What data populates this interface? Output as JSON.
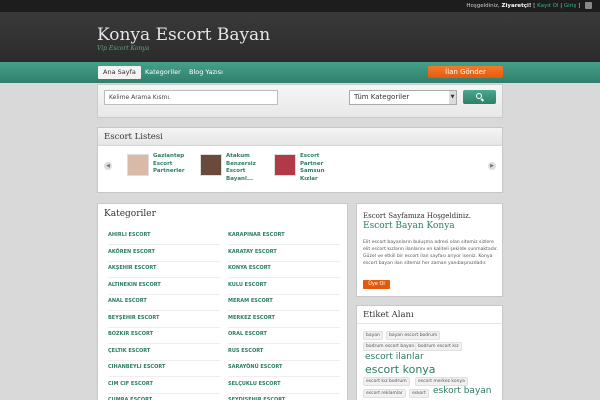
{
  "topbar": {
    "greeting": "Hoşgeldiniz, ",
    "user": "Ziyaretçi!",
    "register": "Kayıt Ol",
    "sep": " | ",
    "login": "Giriş"
  },
  "header": {
    "title": "Konya Escort Bayan",
    "subtitle": "Vip Escort Konya"
  },
  "nav": {
    "items": [
      "Ana Sayfa",
      "Kategoriler",
      "Blog Yazısı"
    ],
    "send_button": "İlan Gönder"
  },
  "search": {
    "placeholder": "Kelime Arama Kısmı.",
    "category_selected": "Tüm Kategoriler"
  },
  "escort_list": {
    "title": "Escort Listesi",
    "items": [
      {
        "name": "Gaziantep Escort Partnerler"
      },
      {
        "name": "Atakum Benzersiz Escort Bayanl..."
      },
      {
        "name": "Escort Partner Samsun Kızlar"
      }
    ]
  },
  "categories": {
    "title": "Kategoriler",
    "left": [
      "AHIRLI ESCORT",
      "AKÖREN ESCORT",
      "AKŞEHIR ESCORT",
      "ALTINEKIN ESCORT",
      "ANAL ESCORT",
      "BEYŞEHIR ESCORT",
      "BOZKIR ESCORT",
      "ÇELTIK ESCORT",
      "CIHANBEYLI ESCORT",
      "CIM CIF ESCORT",
      "CUMRA ESCORT"
    ],
    "right": [
      "KARAPINAR ESCORT",
      "KARATAY ESCORT",
      "KONYA ESCORT",
      "KULU ESCORT",
      "MERAM ESCORT",
      "MERKEZ ESCORT",
      "ORAL ESCORT",
      "RUS ESCORT",
      "SARAYÖNÜ ESCORT",
      "SELÇUKLU ESCORT",
      "SEYDIŞEHIR ESCORT"
    ]
  },
  "welcome": {
    "line1": "Escort Sayfamıza Hoşgeldiniz.",
    "line2": "Escort Bayan Konya",
    "body": "Elit escort bayanların buluşma adresi olan sitemiz sizlere elit escort kızların ilanlarını en kaliteli şekilde sunmaktadır. Güzel ve etkili bir escort ilan sayfası arıyor iseniz. Konya escort bayan ilan sitemiz her zaman yanıbaşınızdadır.",
    "button": "Üye Ol"
  },
  "tags": {
    "title": "Etiket Alanı",
    "items": [
      "bayan",
      "bayan escort bodrum",
      "bodrum escort bayan",
      "bodrum escort kız",
      "escort ilanlar",
      "escort konya",
      "escort kız bodrum",
      "escort merkez konya",
      "escort reklamlar",
      "eskort",
      "eskort bayan"
    ]
  }
}
